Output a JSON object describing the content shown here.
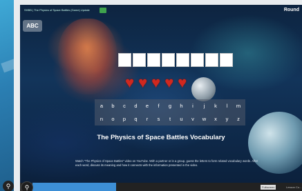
{
  "prev_card": {
    "fab_icon": "search-icon"
  },
  "activity": {
    "video_title": "SHBB | The Physics of Space Battles (Game) Update",
    "round_label": "Round",
    "badge": "ABC",
    "word_blanks": 8,
    "hearts": 5,
    "keyboard_rows": [
      [
        "a",
        "b",
        "c",
        "d",
        "e",
        "f",
        "g",
        "h",
        "i",
        "j",
        "k",
        "l",
        "m"
      ],
      [
        "n",
        "o",
        "p",
        "q",
        "r",
        "s",
        "t",
        "u",
        "v",
        "w",
        "x",
        "y",
        "z"
      ]
    ],
    "title": "The Physics of Space Battles Vocabulary",
    "instructions": "Watch \"The Physics of Space Battles\" video on YouTube. With a partner or in a group, guess the letters to form related vocabulary words. After each word, discuss its meaning and how it connects with the information presented in the video.",
    "progress": 0.31,
    "fullscreen_label": "Fullscreen",
    "footer_extra": "Lesson Co..."
  },
  "colors": {
    "accent": "#3d8fd6",
    "heart": "#d0281f",
    "badge_green": "#3fa34d"
  },
  "icons": {
    "fab": "search-icon",
    "heart": "heart-icon"
  }
}
